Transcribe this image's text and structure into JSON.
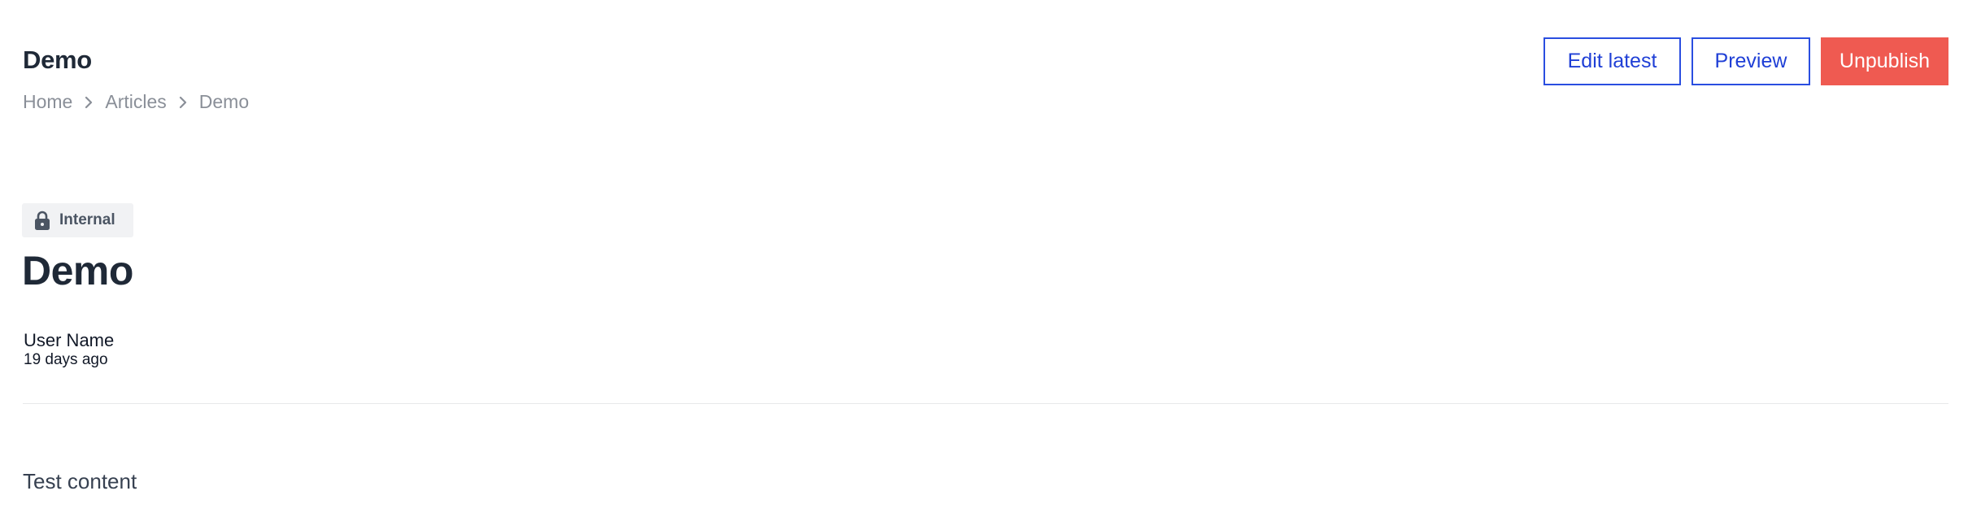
{
  "header": {
    "title": "Demo",
    "breadcrumb": [
      "Home",
      "Articles",
      "Demo"
    ]
  },
  "actions": {
    "edit_latest": "Edit latest",
    "preview": "Preview",
    "unpublish": "Unpublish"
  },
  "article": {
    "visibility_badge": "Internal",
    "badge_icon": "lock-icon",
    "title": "Demo",
    "author": "User Name",
    "timestamp": "19 days ago",
    "content": "Test content"
  },
  "colors": {
    "accent": "#1f3fd6",
    "danger": "#ef5a51"
  }
}
